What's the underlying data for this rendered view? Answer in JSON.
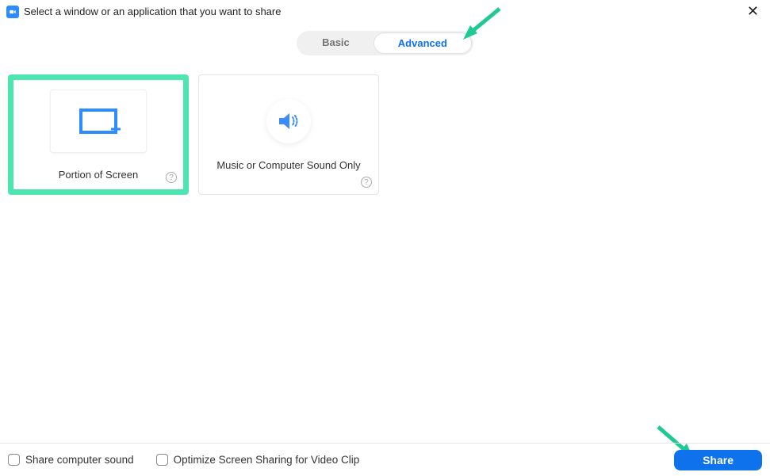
{
  "header": {
    "title": "Select a window or an application that you want to share"
  },
  "tabs": {
    "basic": "Basic",
    "advanced": "Advanced"
  },
  "options": {
    "portion": {
      "label": "Portion of Screen"
    },
    "sound": {
      "label": "Music or Computer Sound Only"
    }
  },
  "footer": {
    "share_sound": "Share computer sound",
    "optimize_video": "Optimize Screen Sharing for Video Clip",
    "share_button": "Share"
  },
  "colors": {
    "accent": "#0e72ed",
    "highlight": "#4de6b0"
  }
}
